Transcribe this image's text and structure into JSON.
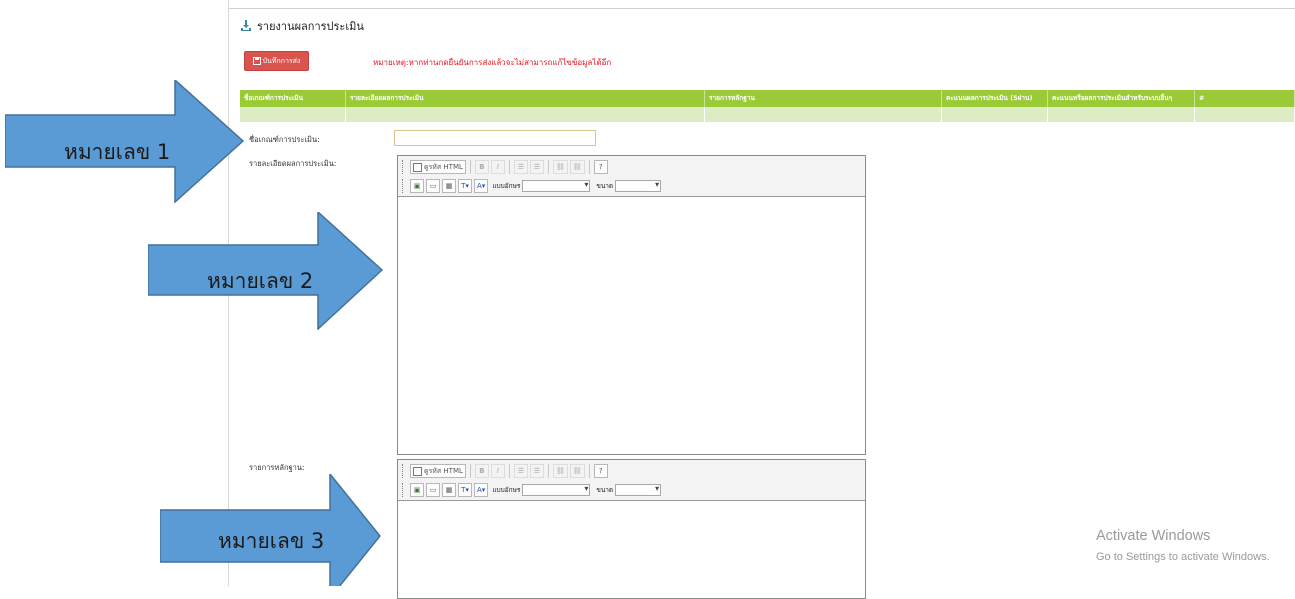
{
  "header": {
    "title": "รายงานผลการประเมิน",
    "icon": "download-icon",
    "accent": "#3a87ad"
  },
  "save_button": {
    "label": "บันทึกการส่ง",
    "icon": "floppy-icon",
    "color": "#d9534f"
  },
  "note": "หมายเหตุ:หากท่านกดยืนยันการส่งแล้วจะไม่สามารถแก้ไขข้อมูลได้อีก",
  "table": {
    "header_color": "#9acb37",
    "columns": [
      "ชื่อเกณฑ์การประเมิน",
      "รายละเอียดผลการประเมิน",
      "รายการหลักฐาน",
      "คะแนนผลการประเมิน (5ผ่าน)",
      "คะแนนหรือผลการประเมินสำหรับระบบอื่นๆ",
      "#"
    ]
  },
  "form": {
    "criteria_label": "ชื่อเกณฑ์การประเมิน:",
    "criteria_value": "",
    "detail_label": "รายละเอียดผลการประเมิน:",
    "evidence_label": "รายการหลักฐาน:"
  },
  "editor": {
    "html_label": "ดูรหัส HTML",
    "bold": "B",
    "italic": "I",
    "font_label": "แบบอักษร",
    "size_label": "ขนาด"
  },
  "callouts": [
    "หมายเลข 1",
    "หมายเลข 2",
    "หมายเลข 3"
  ],
  "callout_color": "#5b9bd5",
  "watermark": {
    "line1": "Activate Windows",
    "line2": "Go to Settings to activate Windows."
  }
}
